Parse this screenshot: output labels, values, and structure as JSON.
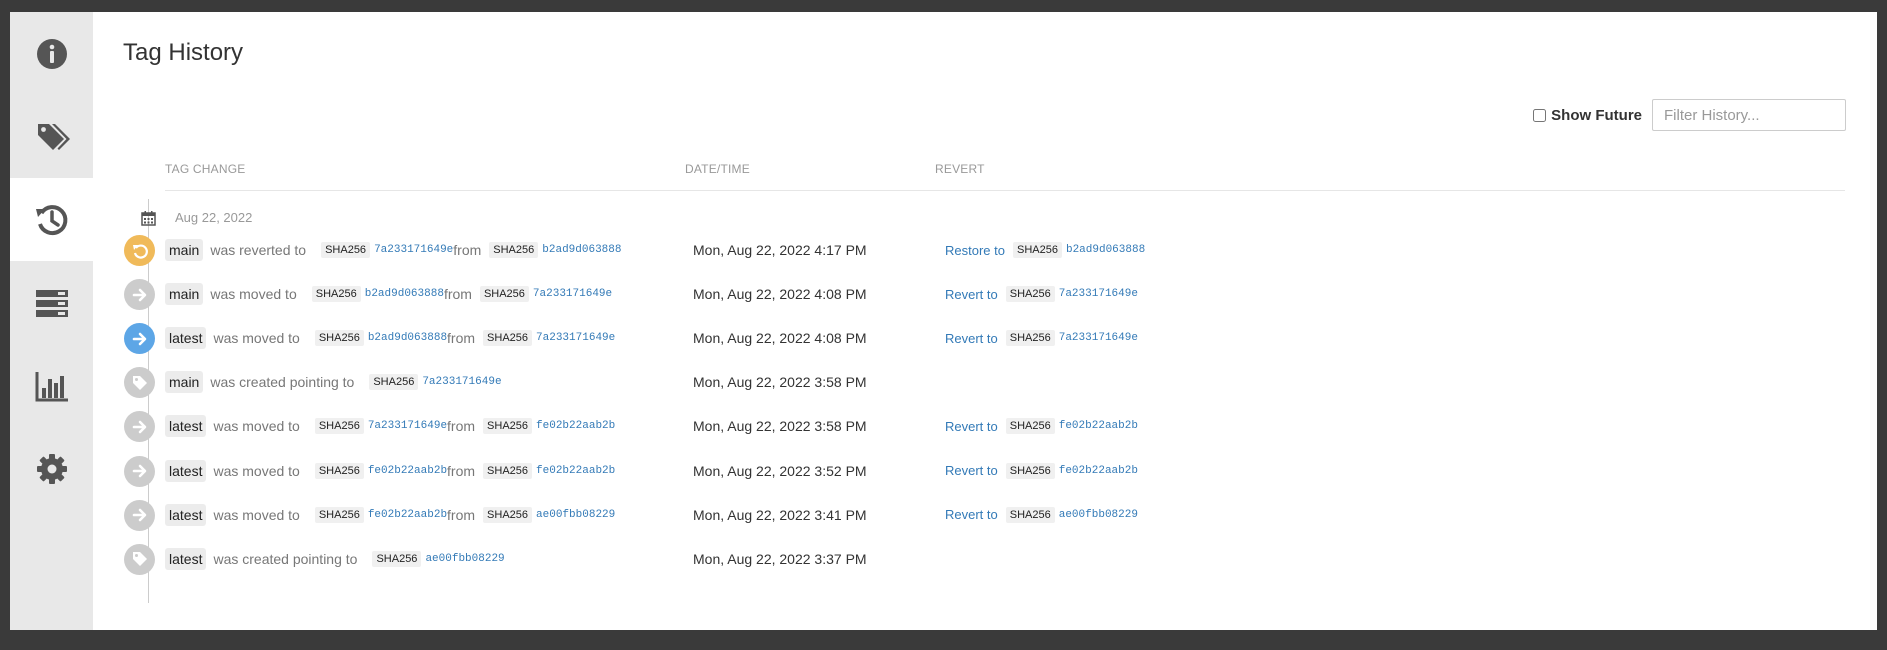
{
  "page": {
    "title": "Tag History"
  },
  "sidebar": {
    "items": [
      {
        "id": "info",
        "icon": "info-circle-icon"
      },
      {
        "id": "tags",
        "icon": "tags-icon"
      },
      {
        "id": "history",
        "icon": "history-icon",
        "active": true
      },
      {
        "id": "layers",
        "icon": "layers-icon"
      },
      {
        "id": "usage",
        "icon": "bar-chart-icon"
      },
      {
        "id": "settings",
        "icon": "gear-icon"
      }
    ]
  },
  "filters": {
    "show_future_label": "Show Future",
    "show_future_checked": false,
    "filter_placeholder": "Filter History..."
  },
  "table": {
    "columns": {
      "change": "TAG CHANGE",
      "datetime": "DATE/TIME",
      "revert": "REVERT"
    },
    "date_header": "Aug 22, 2022",
    "rows": [
      {
        "icon": "revert-icon",
        "icon_color": "#f0ba5a",
        "tag": "main",
        "verb": "was reverted to",
        "to_alg": "SHA256",
        "to_digest": "7a233171649e",
        "from_word": "from",
        "from_alg": "SHA256",
        "from_digest": "b2ad9d063888",
        "datetime": "Mon, Aug 22, 2022 4:17 PM",
        "revert_label": "Restore to",
        "revert_alg": "SHA256",
        "revert_digest": "b2ad9d063888"
      },
      {
        "icon": "arrow-right-icon",
        "icon_color": "#cccccc",
        "tag": "main",
        "verb": "was moved to",
        "to_alg": "SHA256",
        "to_digest": "b2ad9d063888",
        "from_word": "from",
        "from_alg": "SHA256",
        "from_digest": "7a233171649e",
        "datetime": "Mon, Aug 22, 2022 4:08 PM",
        "revert_label": "Revert to",
        "revert_alg": "SHA256",
        "revert_digest": "7a233171649e"
      },
      {
        "icon": "arrow-right-icon",
        "icon_color": "#5da6e6",
        "tag": "latest",
        "verb": "was moved to",
        "to_alg": "SHA256",
        "to_digest": "b2ad9d063888",
        "from_word": "from",
        "from_alg": "SHA256",
        "from_digest": "7a233171649e",
        "datetime": "Mon, Aug 22, 2022 4:08 PM",
        "revert_label": "Revert to",
        "revert_alg": "SHA256",
        "revert_digest": "7a233171649e"
      },
      {
        "icon": "tag-icon",
        "icon_color": "#cccccc",
        "tag": "main",
        "verb": "was created pointing to",
        "to_alg": "SHA256",
        "to_digest": "7a233171649e",
        "datetime": "Mon, Aug 22, 2022 3:58 PM"
      },
      {
        "icon": "arrow-right-icon",
        "icon_color": "#cccccc",
        "tag": "latest",
        "verb": "was moved to",
        "to_alg": "SHA256",
        "to_digest": "7a233171649e",
        "from_word": "from",
        "from_alg": "SHA256",
        "from_digest": "fe02b22aab2b",
        "datetime": "Mon, Aug 22, 2022 3:58 PM",
        "revert_label": "Revert to",
        "revert_alg": "SHA256",
        "revert_digest": "fe02b22aab2b"
      },
      {
        "icon": "arrow-right-icon",
        "icon_color": "#cccccc",
        "tag": "latest",
        "verb": "was moved to",
        "to_alg": "SHA256",
        "to_digest": "fe02b22aab2b",
        "from_word": "from",
        "from_alg": "SHA256",
        "from_digest": "fe02b22aab2b",
        "datetime": "Mon, Aug 22, 2022 3:52 PM",
        "revert_label": "Revert to",
        "revert_alg": "SHA256",
        "revert_digest": "fe02b22aab2b"
      },
      {
        "icon": "arrow-right-icon",
        "icon_color": "#cccccc",
        "tag": "latest",
        "verb": "was moved to",
        "to_alg": "SHA256",
        "to_digest": "fe02b22aab2b",
        "from_word": "from",
        "from_alg": "SHA256",
        "from_digest": "ae00fbb08229",
        "datetime": "Mon, Aug 22, 2022 3:41 PM",
        "revert_label": "Revert to",
        "revert_alg": "SHA256",
        "revert_digest": "ae00fbb08229"
      },
      {
        "icon": "tag-icon",
        "icon_color": "#cccccc",
        "tag": "latest",
        "verb": "was created pointing to",
        "to_alg": "SHA256",
        "to_digest": "ae00fbb08229",
        "datetime": "Mon, Aug 22, 2022 3:37 PM"
      }
    ]
  }
}
